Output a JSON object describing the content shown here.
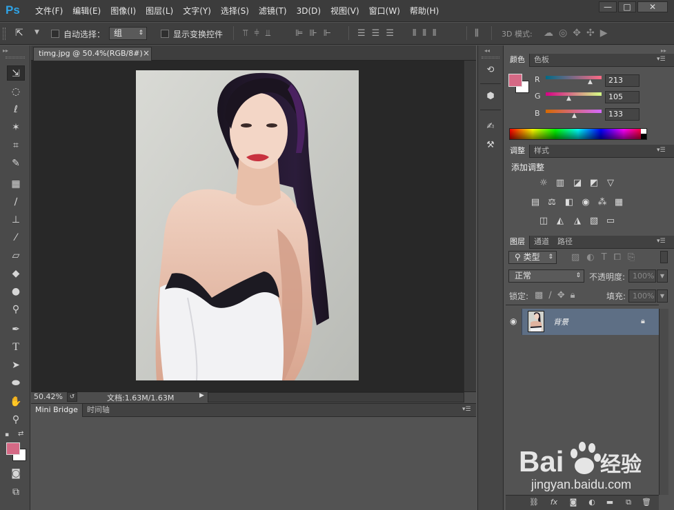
{
  "app": {
    "logo": "Ps"
  },
  "menu": [
    "文件(F)",
    "编辑(E)",
    "图像(I)",
    "图层(L)",
    "文字(Y)",
    "选择(S)",
    "滤镜(T)",
    "3D(D)",
    "视图(V)",
    "窗口(W)",
    "帮助(H)"
  ],
  "window_controls": {
    "minimize": "—",
    "maximize": "□",
    "close": "✕"
  },
  "options": {
    "auto_select_label": "自动选择：",
    "auto_select_value": "组",
    "show_transform_label": "显示变换控件",
    "mode_3d_label": "3D 模式:"
  },
  "document": {
    "tab_title": "timg.jpg @ 50.4%(RGB/8#)",
    "zoom": "50.42%",
    "doc_size": "文档:1.63M/1.63M"
  },
  "bottom_panel": {
    "tabs": [
      "Mini Bridge",
      "时间轴"
    ]
  },
  "color_panel": {
    "tabs": [
      "颜色",
      "色板"
    ],
    "fg_color": "#d56985",
    "bg_color": "#ffffff",
    "r_label": "R",
    "g_label": "G",
    "b_label": "B",
    "r": "213",
    "g": "105",
    "b": "133"
  },
  "adjust_panel": {
    "tabs": [
      "调整",
      "样式"
    ],
    "title": "添加调整"
  },
  "layers_panel": {
    "tabs": [
      "图层",
      "通道",
      "路径"
    ],
    "filter_label": "类型",
    "blend_mode": "正常",
    "opacity_label": "不透明度:",
    "opacity_value": "100%",
    "lock_label": "锁定:",
    "fill_label": "填充:",
    "fill_value": "100%",
    "layers": [
      {
        "name": "背景"
      }
    ]
  },
  "watermark": {
    "brand": "Bai",
    "brand2": "经验",
    "url": "jingyan.baidu.com"
  }
}
